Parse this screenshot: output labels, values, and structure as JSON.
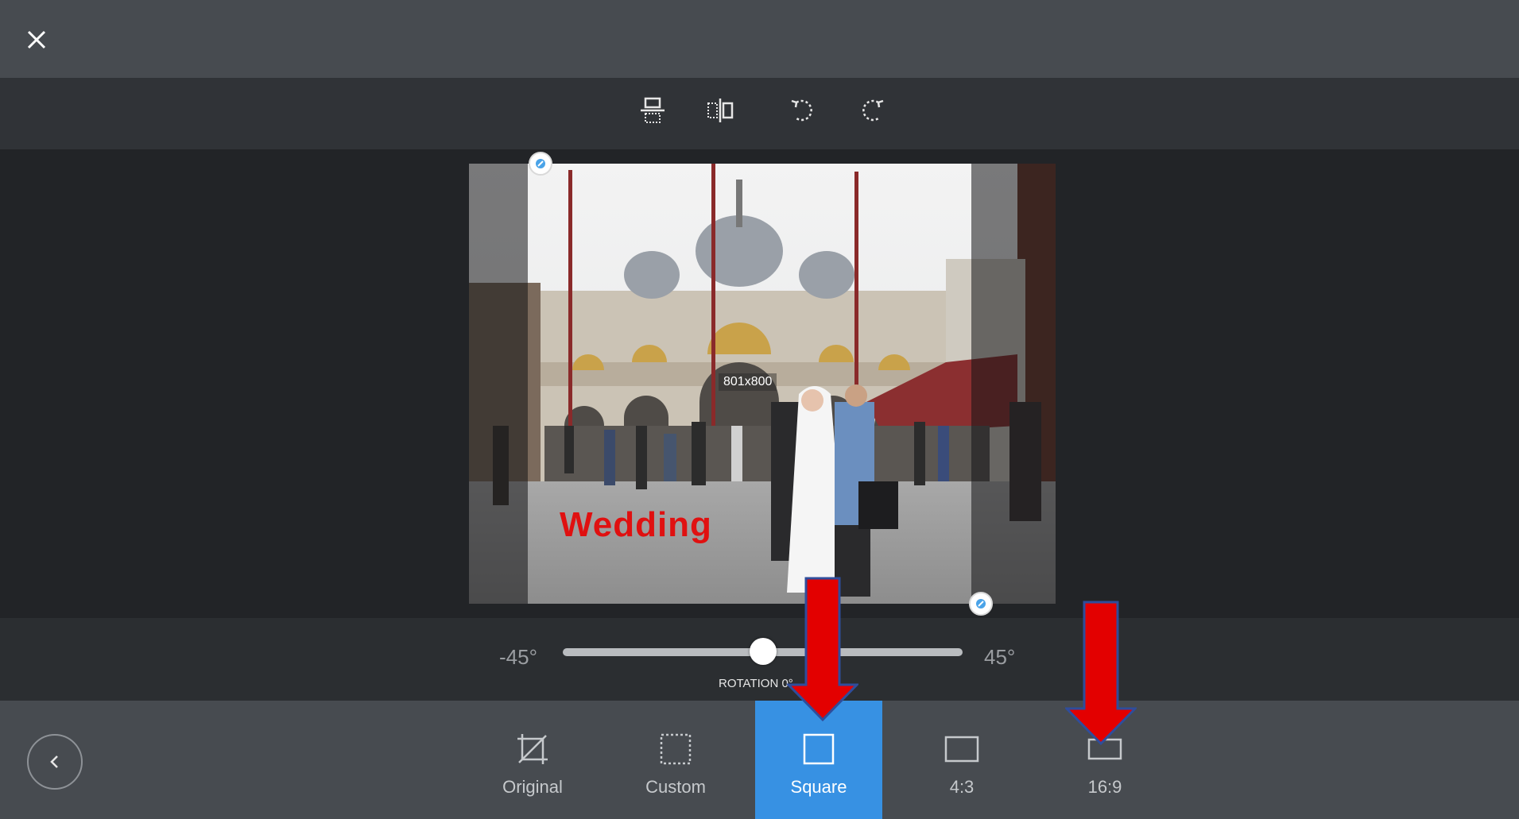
{
  "header": {
    "close_icon": "close-icon"
  },
  "toolbar": {
    "tools": [
      {
        "name": "flip-vertical",
        "icon": "flip-vertical-icon"
      },
      {
        "name": "flip-horizontal",
        "icon": "flip-horizontal-icon"
      },
      {
        "name": "rotate-left",
        "icon": "rotate-left-icon"
      },
      {
        "name": "rotate-right",
        "icon": "rotate-right-icon"
      }
    ]
  },
  "canvas": {
    "crop_size": "801x800",
    "photo_caption": "Wedding"
  },
  "rotation": {
    "min_label": "-45°",
    "max_label": "45°",
    "caption": "ROTATION 0°",
    "value": 0,
    "min": -45,
    "max": 45
  },
  "aspect_ratios": {
    "selected": "Square",
    "options": [
      {
        "label": "Original",
        "icon": "original-crop-icon"
      },
      {
        "label": "Custom",
        "icon": "custom-crop-icon"
      },
      {
        "label": "Square",
        "icon": "square-crop-icon"
      },
      {
        "label": "4:3",
        "icon": "ratio-4-3-icon"
      },
      {
        "label": "16:9",
        "icon": "ratio-16-9-icon"
      }
    ]
  },
  "colors": {
    "accent": "#3791e3",
    "annotation_arrow": "#e30000",
    "wedding_text": "#e01010"
  }
}
